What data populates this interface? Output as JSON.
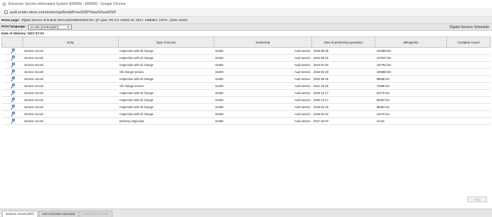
{
  "window": {
    "title": "Electronic Service Information System (ERWIN - ERWIN) - Google Chrome"
  },
  "address": {
    "url": "audi.erwin-store.com/erwin/sp/Retail/FreeDSPView/ShowDSP"
  },
  "breadcrumb": {
    "home": "Home page",
    "rest": " : Digital Service Schedule (WAUZZZ4M0HD022794, Q7 quat. TDI 3.0 V6200 A8, 2017, 4MB0E1, CRTC, Q2W, erwin)"
  },
  "toolbar": {
    "print_language_label": "Print language:",
    "print_language_value": "en-GB (UK/English)",
    "section_title": "Digital Service Schedule"
  },
  "delivery": {
    "text": "Date of delivery: 2017-07-01"
  },
  "table": {
    "headers": {
      "entry": "Entry",
      "type": "Type of service",
      "dealership": "Dealership",
      "date": "Date of performing operations",
      "mileage": "Mileage/km",
      "complete": "Complete record"
    },
    "rows": [
      {
        "entry": "Service record",
        "type": "Inspection with oil change",
        "dealer_code": "31250",
        "dealer_name": "Audi service",
        "date": "2025-06-28",
        "mileage": "153088 km"
      },
      {
        "entry": "Service record",
        "type": "Inspection with oil change",
        "dealer_code": "31250",
        "dealer_name": "Audi service",
        "date": "2024-09-19",
        "mileage": "137537 km"
      },
      {
        "entry": "Service record",
        "type": "Inspection with oil change",
        "dealer_code": "31250",
        "dealer_name": "Audi service",
        "date": "2024-01-04",
        "mileage": "122782 km"
      },
      {
        "entry": "Service record",
        "type": "Oil change service",
        "dealer_code": "31250",
        "dealer_name": "Audi service",
        "date": "2023-02-23",
        "mileage": "106688 km"
      },
      {
        "entry": "Service record",
        "type": "Inspection with oil change",
        "dealer_code": "31250",
        "dealer_name": "Audi service",
        "date": "2022-05-26",
        "mileage": "89568 km"
      },
      {
        "entry": "Service record",
        "type": "Oil change service",
        "dealer_code": "31250",
        "dealer_name": "Audi service",
        "date": "2021-10-26",
        "mileage": "74085 km"
      },
      {
        "entry": "Service record",
        "type": "Inspection with oil change",
        "dealer_code": "31250",
        "dealer_name": "Audi service",
        "date": "2020-12-17",
        "mileage": "52170 km"
      },
      {
        "entry": "Service record",
        "type": "Inspection with oil change",
        "dealer_code": "31250",
        "dealer_name": "Audi service",
        "date": "2020-12-17",
        "mileage": "56487 km"
      },
      {
        "entry": "Service record",
        "type": "Inspection with oil change",
        "dealer_code": "31250",
        "dealer_name": "Audi service",
        "date": "2018-01-16",
        "mileage": "36364 km"
      },
      {
        "entry": "Service record",
        "type": "Inspection with oil change",
        "dealer_code": "31250",
        "dealer_name": "Audi service",
        "date": "2018-03-22",
        "mileage": "14170 km"
      },
      {
        "entry": "Service record",
        "type": "Delivery inspection",
        "dealer_code": "31250",
        "dealer_name": "Audi service",
        "date": "2017-04-07",
        "mileage": "12 km"
      }
    ]
  },
  "print_button": {
    "label": "Print"
  },
  "tabs": [
    {
      "label": "Service record (MT)",
      "state": "active"
    },
    {
      "label": "Anti-corrosion warranty",
      "state": "normal"
    },
    {
      "label": "Workshop contact",
      "state": "disabled"
    }
  ],
  "icons": {
    "view_record": "magnifier-icon"
  },
  "colors": {
    "icon_blue": "#2a58a8",
    "header_gray": "#ececec"
  }
}
